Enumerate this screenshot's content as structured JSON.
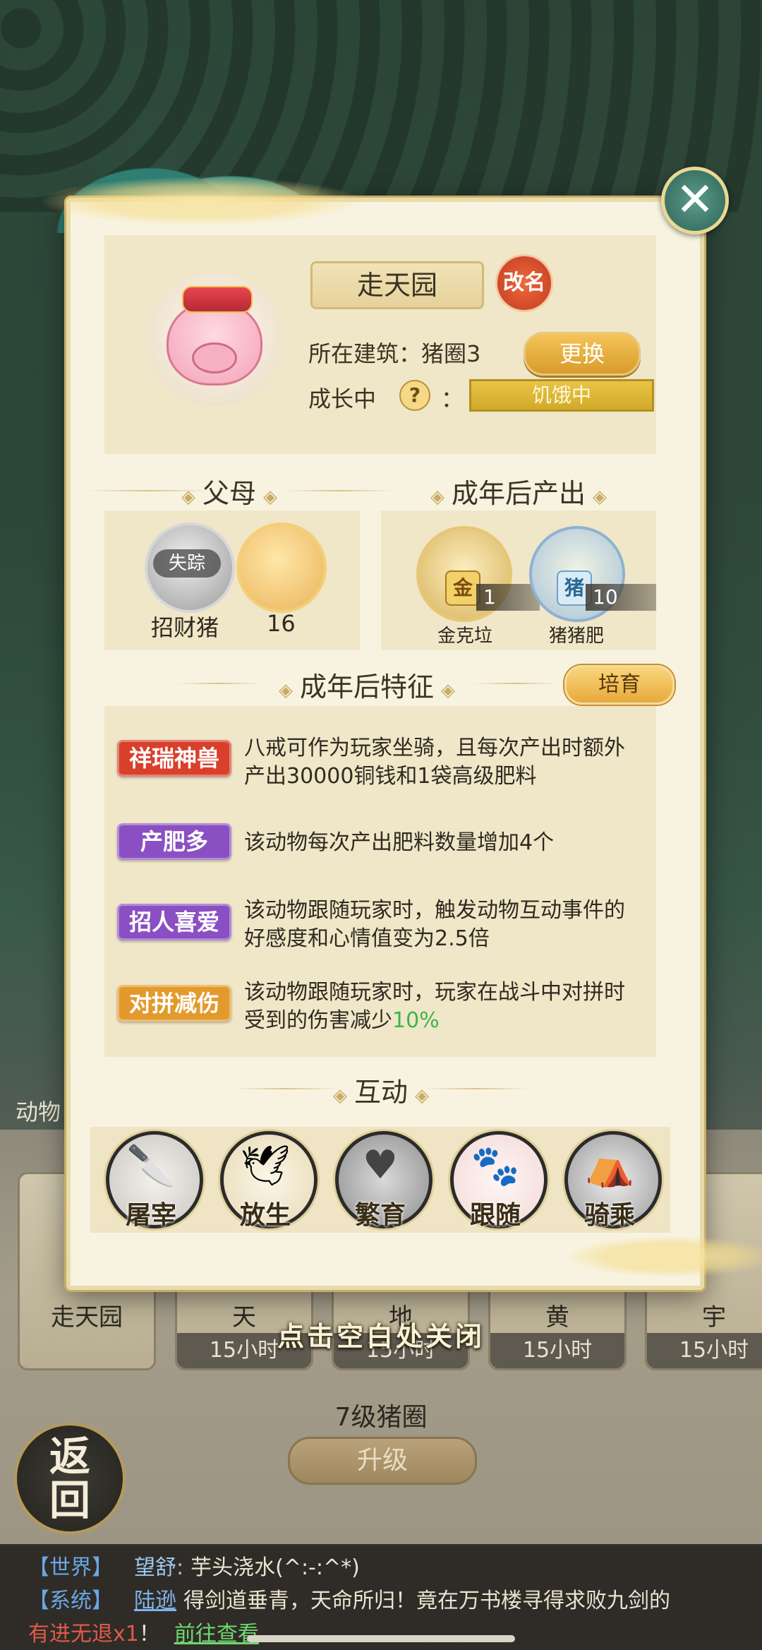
{
  "background": {
    "side_label": "动物",
    "pens": [
      {
        "name": "走天园",
        "time": ""
      },
      {
        "name": "天",
        "time": "15小时"
      },
      {
        "name": "地",
        "time": "15小时"
      },
      {
        "name": "黄",
        "time": "15小时"
      },
      {
        "name": "宇",
        "time": "15小时"
      }
    ],
    "pen_level": "7级猪圈",
    "upgrade_label": "升级",
    "back_label_1": "返",
    "back_label_2": "回",
    "close_hint": "点击空白处关闭"
  },
  "chat": {
    "line1": {
      "tag": "【世界】",
      "name": "望舒:",
      "text": "芋头浇水(^:-:^*)"
    },
    "line2": {
      "tag": "【系统】",
      "name": "陆逊",
      "text": "得剑道垂青，天命所归！竟在万书楼寻得求败九剑的"
    },
    "line3": {
      "red": "有进无退x1",
      "text": "！",
      "link": "前往查看"
    }
  },
  "modal": {
    "close_icon": "close-x",
    "pet_name": "走天园",
    "rename_label": "改名",
    "building_label": "所在建筑：猪圈3",
    "change_label": "更换",
    "growth_label": "成长中",
    "help_glyph": "?",
    "colon": "：",
    "status": "饥饿中",
    "parents_title": "父母",
    "output_title": "成年后产出",
    "parents": [
      {
        "tag": "失踪",
        "name": "招财猪"
      },
      {
        "name": "16"
      }
    ],
    "outputs": [
      {
        "char": "金",
        "count": "1",
        "name": "金克垃"
      },
      {
        "char": "猪",
        "count": "10",
        "name": "猪猪肥"
      }
    ],
    "traits_title": "成年后特征",
    "breed_label": "培育",
    "traits": [
      {
        "badge": "祥瑞神兽",
        "color": "#d8402c",
        "text1": "八戒可作为玩家坐骑，且每次产出时额外",
        "text2": "产出30000铜钱和1袋高级肥料"
      },
      {
        "badge": "产肥多",
        "color": "#8a4fc2",
        "text1": "该动物每次产出肥料数量增加4个",
        "text2": ""
      },
      {
        "badge": "招人喜爱",
        "color": "#8a4fc2",
        "text1": "该动物跟随玩家时，触发动物互动事件的",
        "text2": "好感度和心情值变为2.5倍"
      },
      {
        "badge": "对拼减伤",
        "color": "#e39a2c",
        "text1": "该动物跟随玩家时，玩家在战斗中对拼时",
        "text2_a": "受到的伤害减少",
        "text2_b": "10%"
      }
    ],
    "interact_title": "互动",
    "interactions": [
      {
        "label": "屠宰",
        "icon": "cleaver-icon",
        "glyph": "🔪"
      },
      {
        "label": "放生",
        "icon": "bird-icon",
        "glyph": "🕊"
      },
      {
        "label": "繁育",
        "icon": "hearts-icon",
        "glyph": "♥"
      },
      {
        "label": "跟随",
        "icon": "paw-icon",
        "glyph": "🐾"
      },
      {
        "label": "骑乘",
        "icon": "saddle-icon",
        "glyph": "⛺"
      }
    ]
  }
}
